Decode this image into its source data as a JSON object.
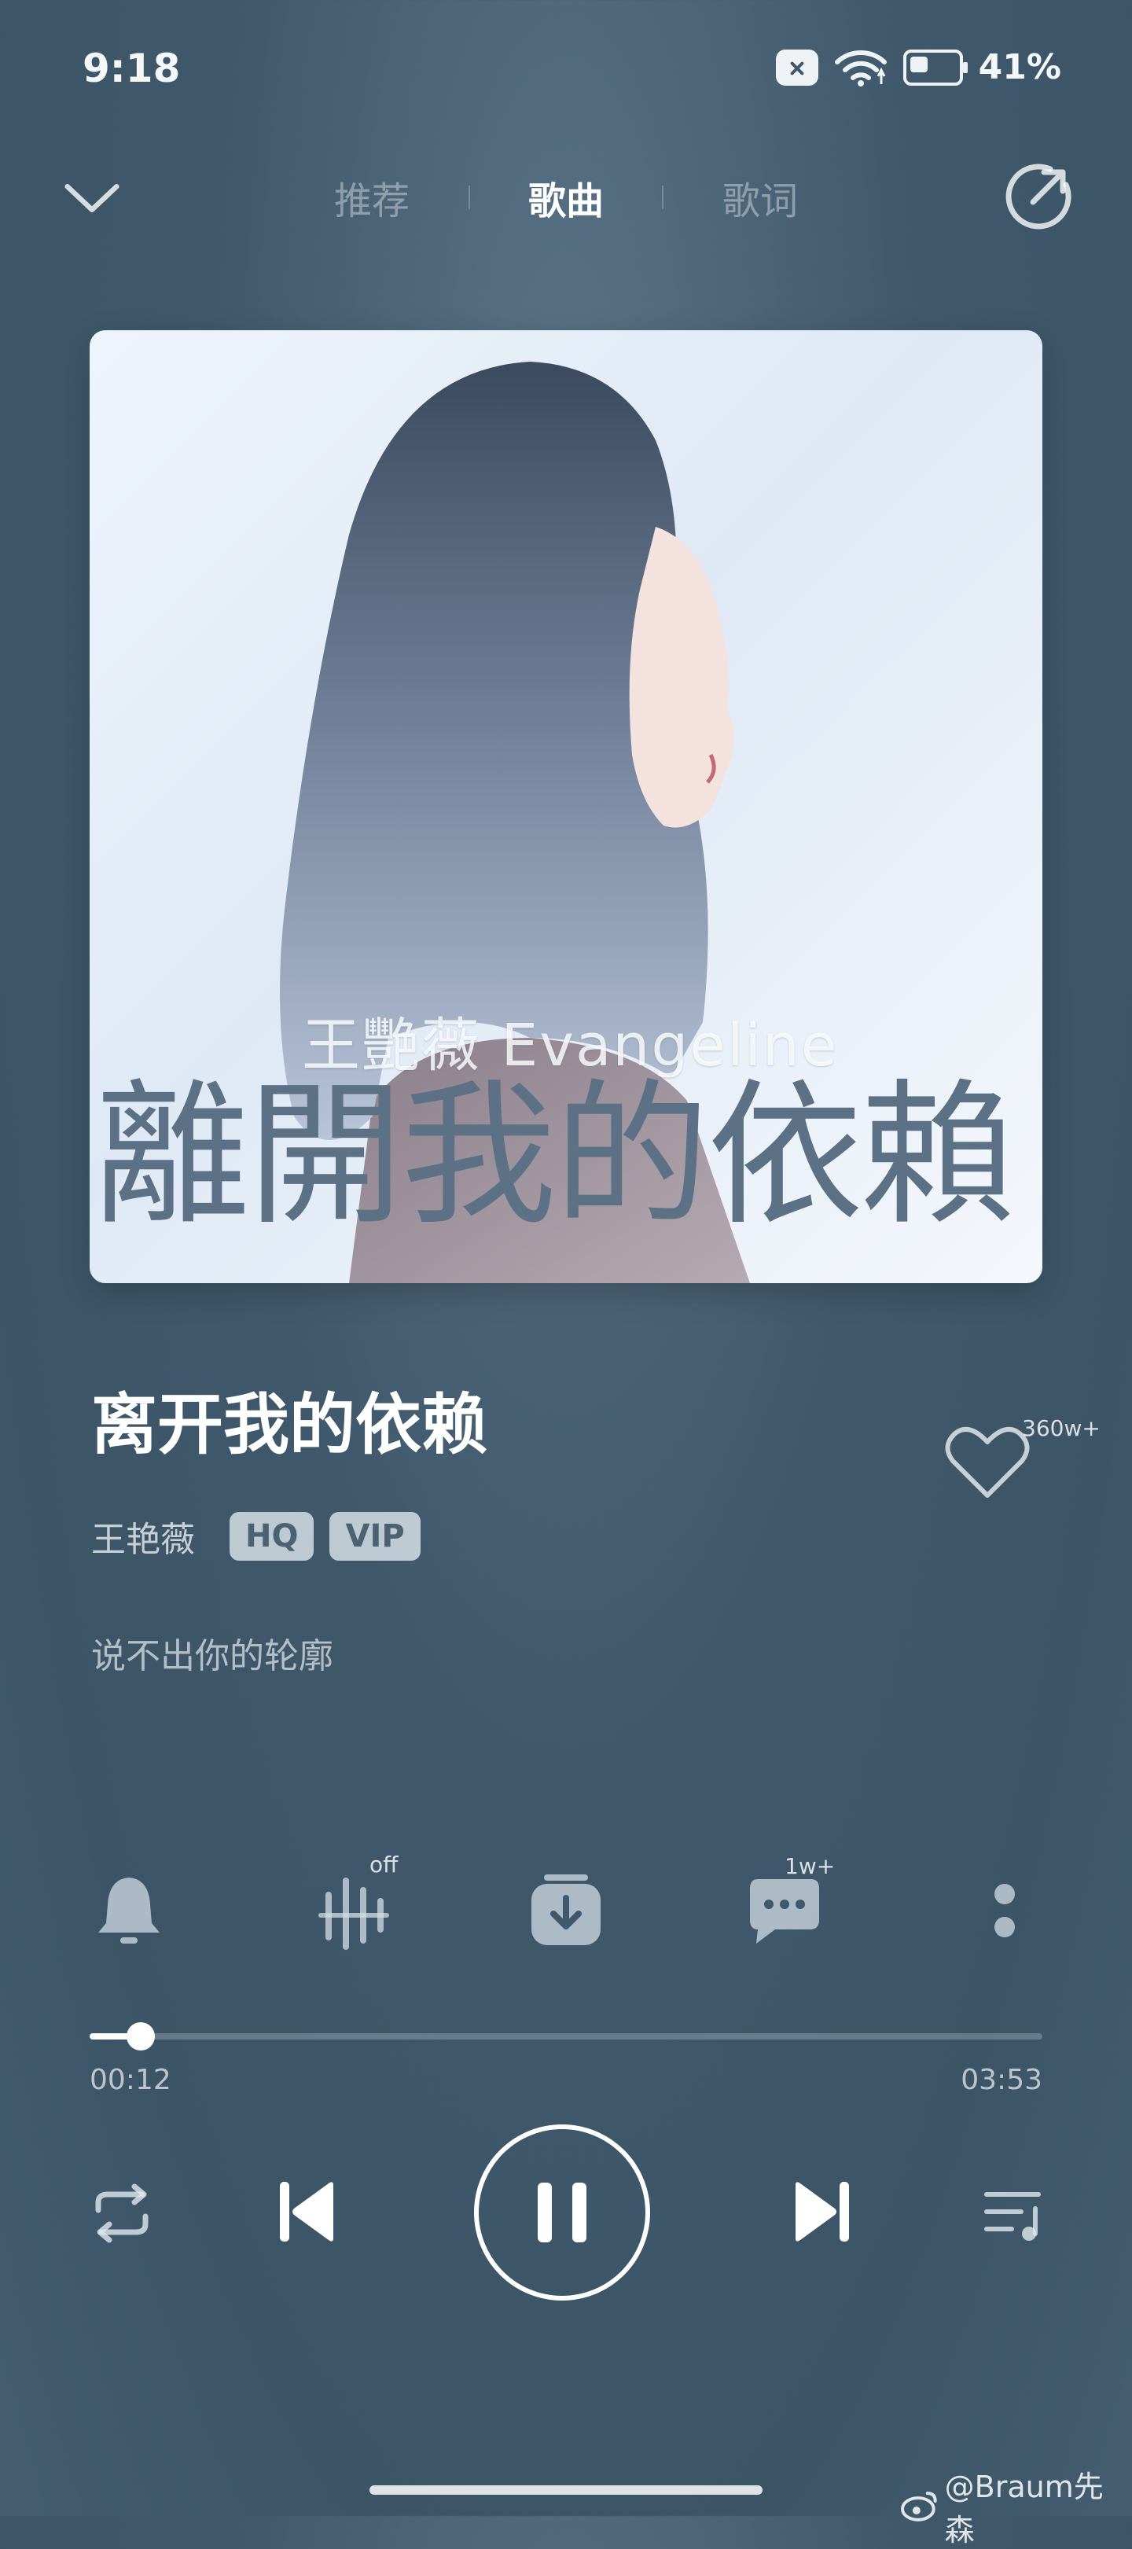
{
  "status_bar": {
    "time": "9:18",
    "battery_percent": "41%",
    "battery_level": 0.41
  },
  "top_nav": {
    "tabs": [
      {
        "label": "推荐",
        "active": false
      },
      {
        "label": "歌曲",
        "active": true
      },
      {
        "label": "歌词",
        "active": false
      }
    ]
  },
  "album_art": {
    "title_text": "離開我的依賴",
    "subtitle_text": "王艷薇 Evangeline"
  },
  "song": {
    "title": "离开我的依赖",
    "artist": "王艳薇",
    "badges": [
      "HQ",
      "VIP"
    ],
    "like_count": "360w+",
    "current_lyric": "说不出你的轮廓"
  },
  "actions": {
    "sound_effect_state": "off",
    "comment_count": "1w+"
  },
  "playback": {
    "current_time": "00:12",
    "total_time": "03:53",
    "progress": 0.054,
    "state": "playing"
  },
  "watermark": {
    "text": "@Braum先森"
  },
  "icons": {
    "collapse": "chevron-down-icon",
    "share": "share-icon",
    "like": "heart-icon",
    "ringtone": "bell-icon",
    "sound_effect": "sound-effect-icon",
    "download": "download-icon",
    "comment": "comment-icon",
    "more": "more-icon",
    "repeat": "repeat-icon",
    "previous": "previous-icon",
    "pause": "pause-icon",
    "next": "next-icon",
    "playlist": "playlist-icon"
  }
}
